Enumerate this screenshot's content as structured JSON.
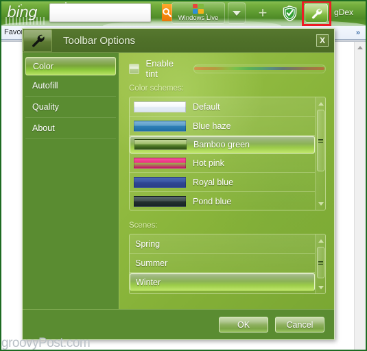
{
  "toolbar": {
    "brand": "bing",
    "search_value": "",
    "search_placeholder": "",
    "search_icon": "magnifier-icon",
    "windows_live_label": "Windows Live",
    "windows_live_icon": "windows-flag-icon",
    "dropdown_icon": "chevron-down-icon",
    "add_icon": "plus-icon",
    "shield_icon": "shield-check-icon",
    "options_icon": "wrench-icon",
    "account_label": "gDex",
    "highlight_color": "#ee1c25"
  },
  "browser": {
    "favorites_label": "Favor",
    "overflow_icon": "double-chevron-right-icon",
    "scroll_up_icon": "triangle-up-icon"
  },
  "dialog": {
    "title": "Toolbar Options",
    "title_icon": "wrench-icon",
    "close_label": "X",
    "sidebar": {
      "items": [
        {
          "label": "Color",
          "selected": true
        },
        {
          "label": "Autofill",
          "selected": false
        },
        {
          "label": "Quality",
          "selected": false
        },
        {
          "label": "About",
          "selected": false
        }
      ]
    },
    "tint": {
      "label": "Enable tint",
      "checked": false,
      "checkbox_icon": "checkbox-icon",
      "gradient_name": "tint-gradient-strip"
    },
    "color_schemes": {
      "label": "Color schemes:",
      "items": [
        {
          "label": "Default",
          "color_top": "#ffffff",
          "color_bottom": "#dde7f2",
          "selected": false
        },
        {
          "label": "Blue haze",
          "color_top": "#7fb4d8",
          "color_bottom": "#1f6ea8",
          "selected": false
        },
        {
          "label": "Bamboo green",
          "color_top": "#c3d79a",
          "color_bottom": "#2f5216",
          "selected": true
        },
        {
          "label": "Hot pink",
          "color_top": "#f4569b",
          "color_bottom": "#c7136a",
          "selected": false
        },
        {
          "label": "Royal blue",
          "color_top": "#4a68b4",
          "color_bottom": "#2b3f86",
          "selected": false
        },
        {
          "label": "Pond blue",
          "color_top": "#5a6a6e",
          "color_bottom": "#172426",
          "selected": false
        }
      ],
      "scroll_up_icon": "triangle-up-icon",
      "scroll_down_icon": "triangle-down-icon",
      "scroll_thumb_icon": "scrollbar-thumb-grip"
    },
    "scenes": {
      "label": "Scenes:",
      "items": [
        {
          "label": "Spring",
          "selected": false
        },
        {
          "label": "Summer",
          "selected": false
        },
        {
          "label": "Winter",
          "selected": true
        }
      ],
      "scroll_up_icon": "triangle-up-icon",
      "scroll_down_icon": "triangle-down-icon",
      "scroll_thumb_icon": "scrollbar-thumb-grip"
    },
    "footer": {
      "ok_label": "OK",
      "cancel_label": "Cancel"
    }
  },
  "watermark": "groovyPost.com"
}
